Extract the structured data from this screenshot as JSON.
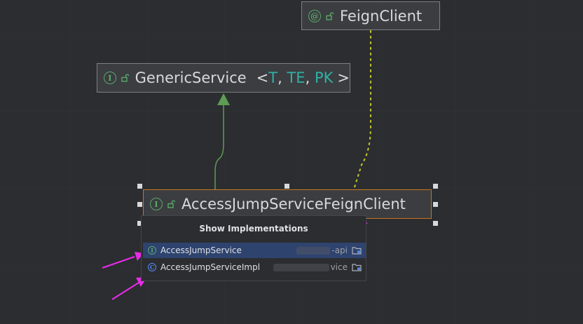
{
  "nodes": {
    "feign_client": {
      "kind": "@",
      "name": "FeignClient"
    },
    "generic_service": {
      "kind": "I",
      "name": "GenericService",
      "type_params_open": "<",
      "type_params": [
        "T",
        "TE",
        "PK"
      ],
      "type_params_close": ">"
    },
    "access_jump": {
      "kind": "I",
      "name": "AccessJumpServiceFeignClient"
    }
  },
  "popup": {
    "title": "Show Implementations",
    "items": [
      {
        "kind": "I",
        "name": "AccessJumpService",
        "module_suffix": "-api",
        "selected": true
      },
      {
        "kind": "C",
        "name": "AccessJumpServiceImpl",
        "module_suffix": "vice",
        "selected": false
      }
    ]
  },
  "colors": {
    "background": "#2b2d30",
    "node_fill": "#3b3d40",
    "node_border": "#7d7f83",
    "selected_border": "#c8741d",
    "interface_green": "#59a869",
    "class_blue": "#548af7",
    "type_param_teal": "#2fb1a6",
    "inheritance_edge": "#5e9c55",
    "annotation_edge": "#bcbc2c",
    "popup_selection": "#2e436e",
    "annotation_arrow": "#e62ce6"
  },
  "icons": {
    "node_lock": "lock-open-icon",
    "popup_module": "module-folder-icon"
  }
}
